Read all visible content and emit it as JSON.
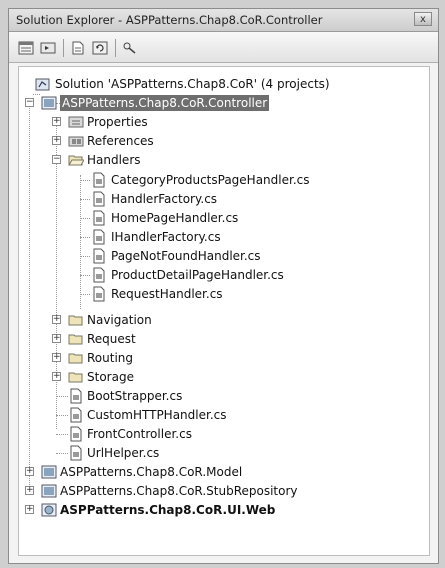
{
  "window": {
    "title": "Solution Explorer - ASPPatterns.Chap8.CoR.Controller",
    "close_glyph": "x"
  },
  "toolbar": {
    "buttons": [
      {
        "icon": "properties-icon"
      },
      {
        "icon": "show-all-files-icon"
      },
      {
        "icon": "view-code-icon"
      },
      {
        "icon": "refresh-icon"
      },
      {
        "icon": "class-diagram-icon"
      }
    ]
  },
  "tree": {
    "solution": "Solution 'ASPPatterns.Chap8.CoR' (4 projects)",
    "controller": "ASPPatterns.Chap8.CoR.Controller",
    "properties": "Properties",
    "references": "References",
    "handlers": "Handlers",
    "handler_files": [
      "CategoryProductsPageHandler.cs",
      "HandlerFactory.cs",
      "HomePageHandler.cs",
      "IHandlerFactory.cs",
      "PageNotFoundHandler.cs",
      "ProductDetailPageHandler.cs",
      "RequestHandler.cs"
    ],
    "folders": [
      "Navigation",
      "Request",
      "Routing",
      "Storage"
    ],
    "files": [
      "BootStrapper.cs",
      "CustomHTTPHandler.cs",
      "FrontController.cs",
      "UrlHelper.cs"
    ],
    "projects": [
      "ASPPatterns.Chap8.CoR.Model",
      "ASPPatterns.Chap8.CoR.StubRepository",
      "ASPPatterns.Chap8.CoR.UI.Web"
    ]
  },
  "colors": {
    "selection": "#6e6e6e",
    "folder": "#e9d79a",
    "file": "#ffffff"
  }
}
